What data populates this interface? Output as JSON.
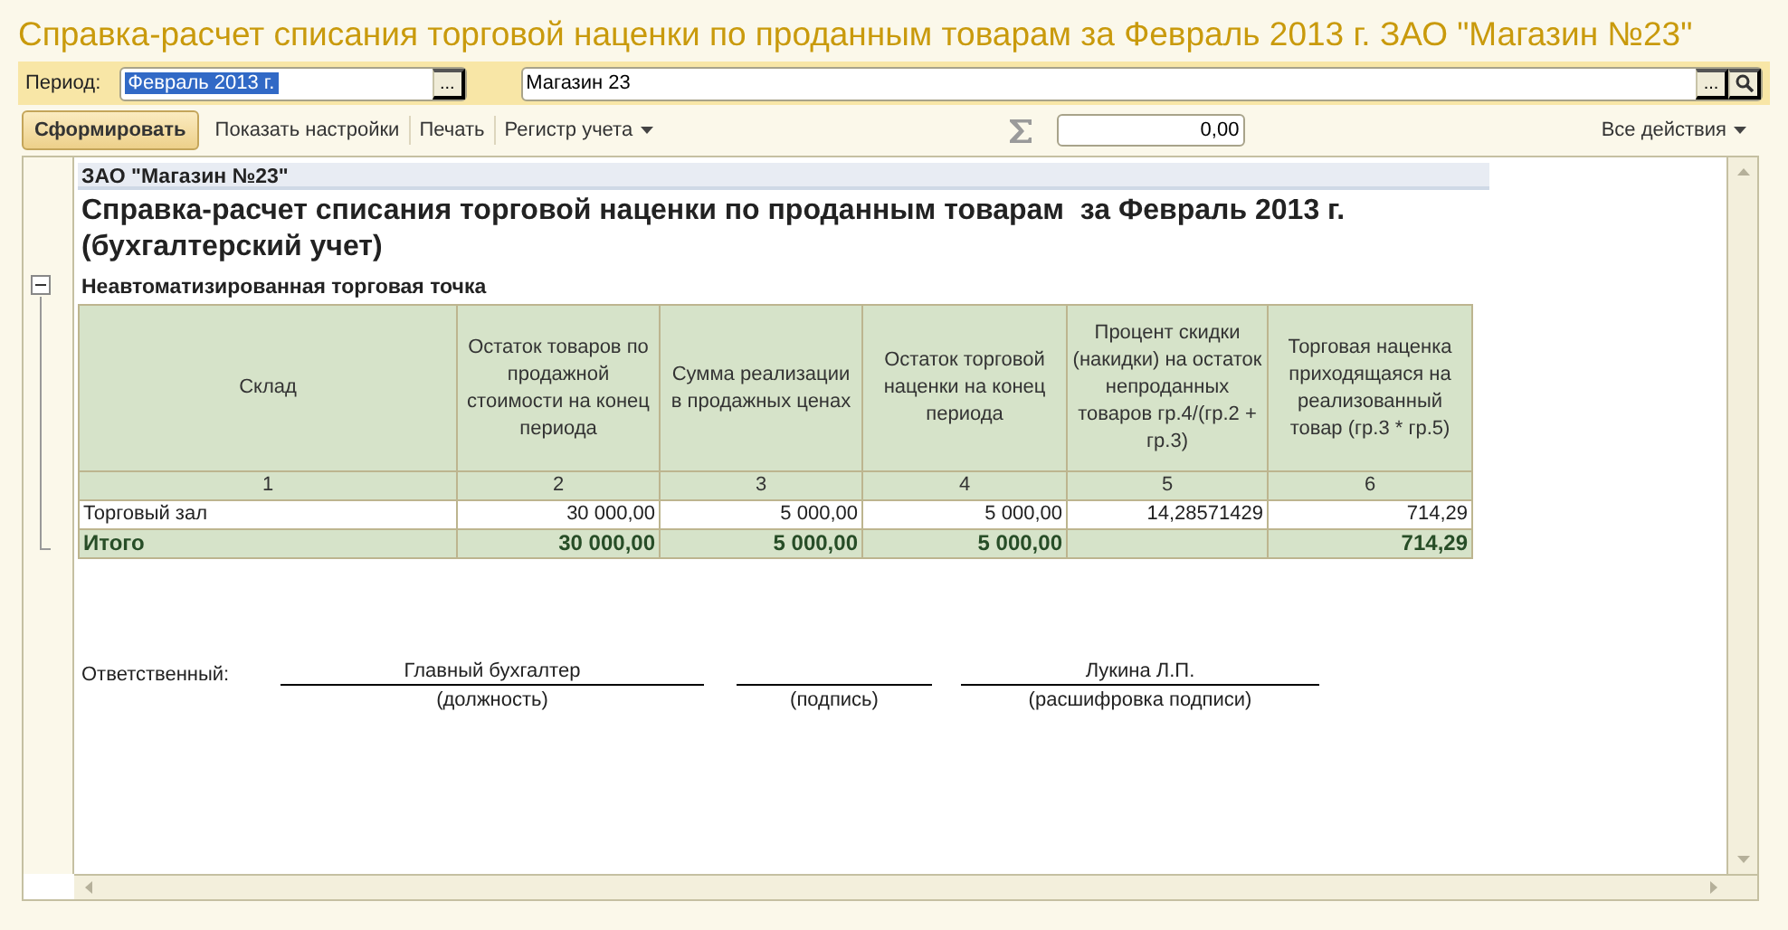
{
  "window": {
    "title": "Справка-расчет списания торговой наценки по проданным товарам за Февраль 2013 г. ЗАО \"Магазин №23\""
  },
  "filter_bar": {
    "period_label": "Период:",
    "period_value": "Февраль 2013 г.",
    "period_selected": true,
    "period_button": "...",
    "organization_value": "Магазин 23",
    "organization_button": "..."
  },
  "toolbar": {
    "buttons": [
      {
        "label": "Сформировать",
        "kind": "primary"
      },
      {
        "label": "Показать настройки",
        "kind": "link"
      },
      {
        "label": "Печать",
        "kind": "link"
      },
      {
        "label": "Регистр учета",
        "kind": "dropdown"
      }
    ],
    "sum_value": "0,00",
    "all_actions": "Все действия"
  },
  "report": {
    "company": "ЗАО \"Магазин №23\"",
    "title": "Справка-расчет списания торговой наценки по проданным товарам  за Февраль 2013 г.",
    "subtitle": "(бухгалтерский учет)",
    "group": {
      "label": "Неавтоматизированная торговая точка",
      "expanded": true
    },
    "table": {
      "columns": [
        "Склад",
        "Остаток товаров по продажной стоимости на конец периода",
        "Сумма реализации в продажных ценах",
        "Остаток торговой наценки на конец периода",
        "Процент скидки (накидки) на остаток непроданных товаров гр.4/(гр.2 + гр.3)",
        "Торговая наценка приходящаяся на реализованный товар (гр.3 * гр.5)"
      ],
      "column_numbers": [
        "1",
        "2",
        "3",
        "4",
        "5",
        "6"
      ],
      "rows": [
        {
          "total": false,
          "cells": [
            "Торговый зал",
            "30 000,00",
            "5 000,00",
            "5 000,00",
            "14,28571429",
            "714,29"
          ]
        },
        {
          "total": true,
          "cells": [
            "Итого",
            "30 000,00",
            "5 000,00",
            "5 000,00",
            "",
            "714,29"
          ]
        }
      ]
    },
    "signatures": {
      "label": "Ответственный:",
      "fields": [
        {
          "value": "Главный бухгалтер",
          "caption": "(должность)"
        },
        {
          "caption": "(подпись)"
        },
        {
          "value": "Лукина  Л.П.",
          "caption": "(расшифровка подписи)"
        }
      ]
    }
  }
}
